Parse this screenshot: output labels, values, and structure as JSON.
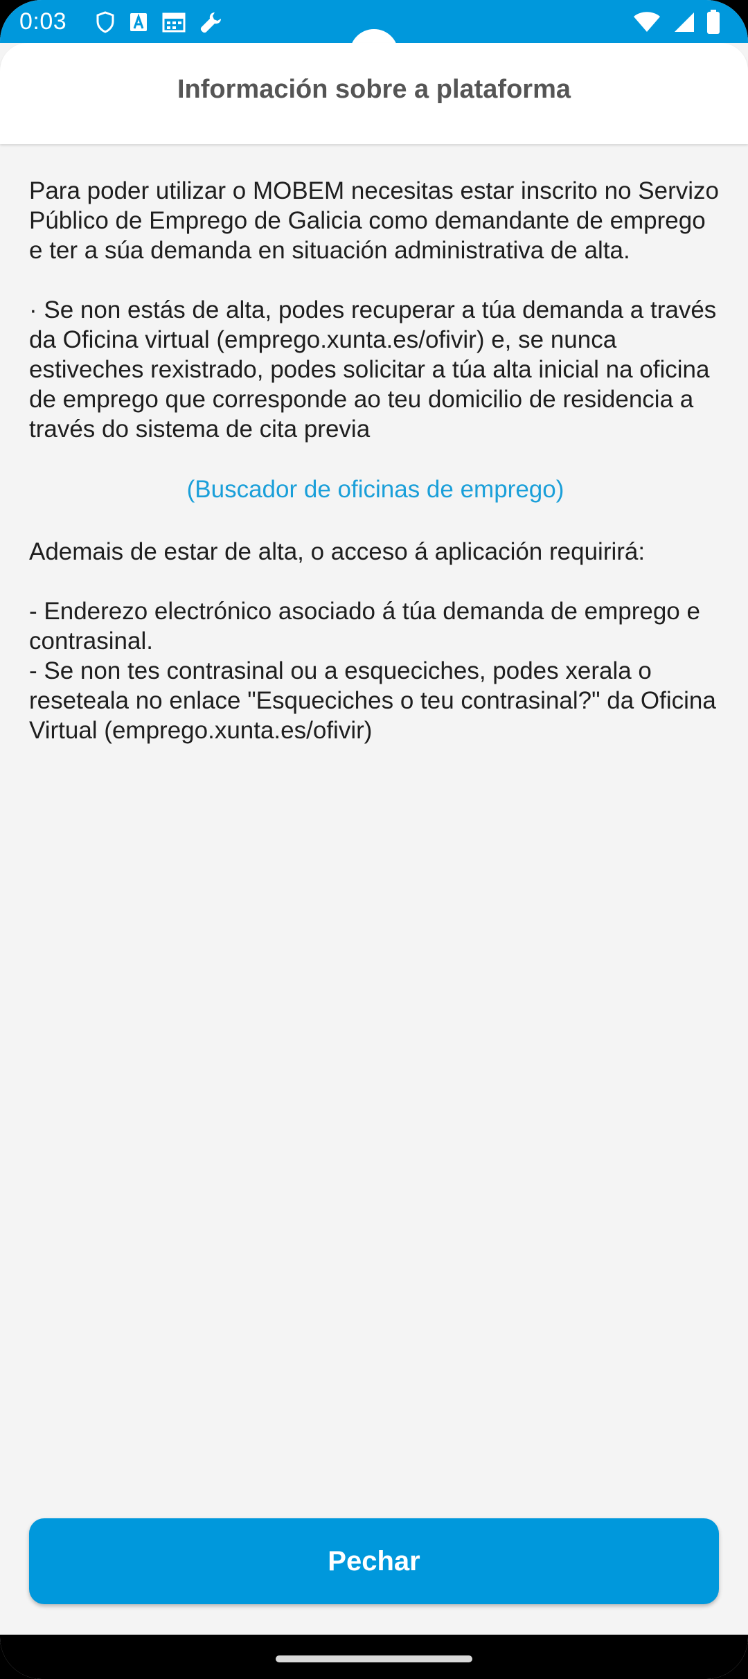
{
  "status_bar": {
    "time": "0:03",
    "left_icons": [
      "shield-icon",
      "text-a-icon",
      "calendar-icon",
      "wrench-icon"
    ],
    "right_icons": [
      "wifi-icon",
      "signal-icon",
      "battery-icon"
    ]
  },
  "header": {
    "title": "Información sobre a plataforma"
  },
  "content": {
    "paragraph_1": "Para poder utilizar o MOBEM necesitas estar inscrito no Servizo Público de Emprego de Galicia como demandante de emprego e ter a súa demanda en situación administrativa de alta.",
    "paragraph_2": "· Se non estás de alta, podes recuperar a túa demanda a través da Oficina virtual (emprego.xunta.es/ofivir) e, se nunca estiveches rexistrado, podes solicitar a túa alta inicial na oficina de emprego que corresponde ao teu domicilio de residencia a través do sistema de cita previa",
    "link_label": "(Buscador de oficinas de emprego)",
    "paragraph_3": "Ademais de estar de alta, o acceso á aplicación requirirá:",
    "requirement_1": "- Enderezo electrónico asociado á túa demanda de emprego e contrasinal.",
    "requirement_2": "- Se non tes contrasinal ou a esqueciches, podes xerala o reseteala no enlace \"Esqueciches o teu contrasinal?\" da Oficina Virtual (emprego.xunta.es/ofivir)"
  },
  "footer": {
    "close_label": "Pechar"
  },
  "colors": {
    "accent": "#0098dc",
    "link": "#1a9fd9",
    "header_text": "#555555",
    "body_text": "#1e1e1e",
    "background": "#f4f4f4"
  }
}
